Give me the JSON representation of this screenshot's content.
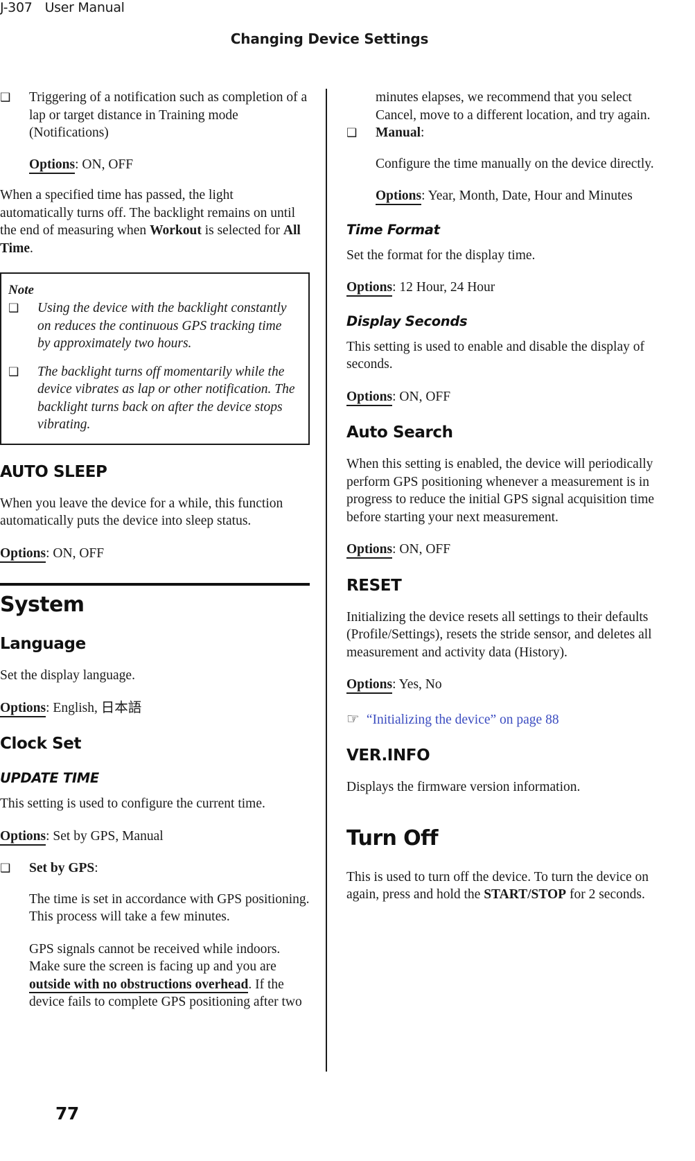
{
  "header": {
    "doc_code": "J-307",
    "doc_type": "User Manual",
    "chapter_title": "Changing Device Settings"
  },
  "link_color": "#3b4cc0",
  "bullet_glyph": "❑",
  "xref_icon_glyph": "☞",
  "left_column": {
    "backlight_bullet": {
      "text": "Triggering of a notification such as completion of a lap or target distance in Training mode (Notifications)",
      "options_label": "Options",
      "options_value": ": ON, OFF"
    },
    "backlight_paragraph_a": "When a specified time has passed, the light automatically turns off. The backlight remains on until the end of measuring when ",
    "backlight_paragraph_b": "Workout",
    "backlight_paragraph_c": " is selected for ",
    "backlight_paragraph_d": "All Time",
    "backlight_paragraph_e": ".",
    "note": {
      "title": "Note",
      "items": [
        "Using the device with the backlight constantly on reduces the continuous GPS tracking time by approximately two hours.",
        "The backlight turns off momentarily while the device vibrates as lap or other notification. The backlight turns back on after the device stops vibrating."
      ]
    },
    "auto_sleep": {
      "heading": "AUTO SLEEP",
      "body": "When you leave the device for a while, this function automatically puts the device into sleep status.",
      "options_label": "Options",
      "options_value": ": ON, OFF"
    },
    "system": {
      "heading": "System"
    },
    "language": {
      "heading": "Language",
      "body": "Set the display language.",
      "options_label": "Options",
      "options_value": ": English, 日本語"
    },
    "clock_set": {
      "heading": "Clock Set",
      "update_time": {
        "heading": "UPDATE TIME",
        "body": "This setting is used to configure the current time.",
        "options_label": "Options",
        "options_value": ": Set by GPS, Manual"
      },
      "set_by_gps": {
        "label": "Set by GPS",
        "label_suffix": ":",
        "paragraph1": "The time is set in accordance with GPS positioning. This process will take a few minutes.",
        "paragraph2_a": "GPS signals cannot be received while indoors. Make sure the screen is facing up and you are ",
        "paragraph2_b": "outside with no obstructions overhead",
        "paragraph2_c": ". If the device fails to complete GPS positioning after two"
      }
    }
  },
  "right_column": {
    "gps_continuation": "minutes elapses, we recommend that you select Cancel, move to a different location, and try again.",
    "manual": {
      "label": "Manual",
      "label_suffix": ":",
      "paragraph": "Configure the time manually on the device directly.",
      "options_label": "Options",
      "options_value": ": Year, Month, Date, Hour and Minutes"
    },
    "time_format": {
      "heading": "Time Format",
      "body": "Set the format for the display time.",
      "options_label": "Options",
      "options_value": ": 12 Hour, 24 Hour"
    },
    "display_seconds": {
      "heading": "Display Seconds",
      "body": "This setting is used to enable and disable the display of seconds.",
      "options_label": "Options",
      "options_value": ": ON, OFF"
    },
    "auto_search": {
      "heading": "Auto Search",
      "body": "When this setting is enabled, the device will periodically perform GPS positioning whenever a measurement is in progress to reduce the initial GPS signal acquisition time before starting your next measurement.",
      "options_label": "Options",
      "options_value": ": ON, OFF"
    },
    "reset": {
      "heading": "RESET",
      "body": "Initializing the device resets all settings to their defaults (Profile/Settings), resets the stride sensor, and deletes all measurement and activity data (History).",
      "options_label": "Options",
      "options_value": ": Yes, No",
      "xref_text": "“Initializing the device” on page 88"
    },
    "ver_info": {
      "heading": "VER.INFO",
      "body": "Displays the firmware version information."
    },
    "turn_off": {
      "heading": "Turn Off",
      "body_a": "This is used to turn off the device. To turn the device on again, press and hold the ",
      "body_b": "START/STOP",
      "body_c": " for 2 seconds."
    }
  },
  "footer": {
    "page_number": "77"
  }
}
